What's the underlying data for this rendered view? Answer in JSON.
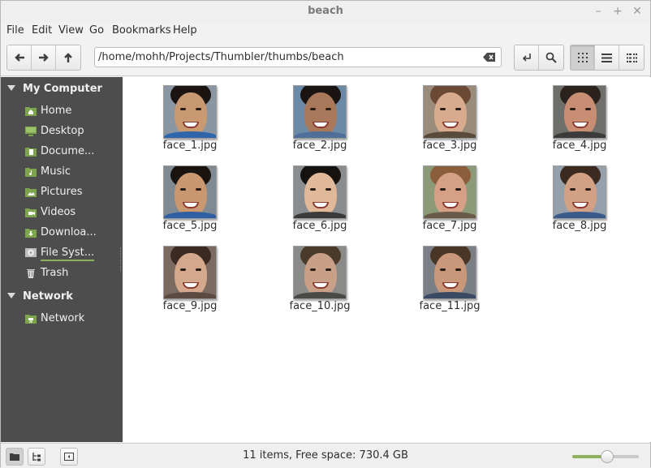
{
  "window": {
    "title": "beach"
  },
  "menu": [
    "File",
    "Edit",
    "View",
    "Go",
    "Bookmarks",
    "Help"
  ],
  "toolbar": {
    "path": "/home/mohh/Projects/Thumbler/thumbs/beach",
    "nav_icons": [
      "back-arrow-icon",
      "forward-arrow-icon",
      "up-arrow-icon"
    ],
    "right_icons": [
      "toggle-location-icon",
      "search-icon"
    ],
    "view_icons": [
      "icon-view-icon",
      "list-view-icon",
      "compact-view-icon"
    ],
    "active_view": "icon-view"
  },
  "sidebar": {
    "sections": [
      {
        "label": "My Computer",
        "items": [
          {
            "label": "Home",
            "icon": "home-folder-icon"
          },
          {
            "label": "Desktop",
            "icon": "desktop-icon"
          },
          {
            "label": "Docume...",
            "icon": "documents-folder-icon"
          },
          {
            "label": "Music",
            "icon": "music-folder-icon"
          },
          {
            "label": "Pictures",
            "icon": "pictures-folder-icon"
          },
          {
            "label": "Videos",
            "icon": "videos-folder-icon"
          },
          {
            "label": "Downloa...",
            "icon": "downloads-folder-icon"
          },
          {
            "label": "File Syst...",
            "icon": "drive-icon"
          },
          {
            "label": "Trash",
            "icon": "trash-icon"
          }
        ]
      },
      {
        "label": "Network",
        "items": [
          {
            "label": "Network",
            "icon": "network-folder-icon"
          }
        ]
      }
    ]
  },
  "files": [
    {
      "name": "face_1.jpg",
      "skin": "#c99a72",
      "hair": "#1b1410",
      "bg": "#8a97a3",
      "shirt": "#2f66a9"
    },
    {
      "name": "face_2.jpg",
      "skin": "#a9785a",
      "hair": "#1a1512",
      "bg": "#6c89a6",
      "shirt": "#4f6f98"
    },
    {
      "name": "face_3.jpg",
      "skin": "#d8ab8e",
      "hair": "#6a4a34",
      "bg": "#9a8c7a",
      "shirt": "#5a4a3c"
    },
    {
      "name": "face_4.jpg",
      "skin": "#c88e74",
      "hair": "#2b221d",
      "bg": "#6e6e6a",
      "shirt": "#3b3b3b"
    },
    {
      "name": "face_5.jpg",
      "skin": "#c99870",
      "hair": "#1a1410",
      "bg": "#7f8a93",
      "shirt": "#2f5fa0"
    },
    {
      "name": "face_6.jpg",
      "skin": "#e0b89a",
      "hair": "#161210",
      "bg": "#8a8d90",
      "shirt": "#3a3a3a"
    },
    {
      "name": "face_7.jpg",
      "skin": "#d6a086",
      "hair": "#8a5e3a",
      "bg": "#8d9a78",
      "shirt": "#6a5a4a"
    },
    {
      "name": "face_8.jpg",
      "skin": "#d2a084",
      "hair": "#3a2a20",
      "bg": "#96a0aa",
      "shirt": "#3a5a8a"
    },
    {
      "name": "face_9.jpg",
      "skin": "#d4a88c",
      "hair": "#3a2a20",
      "bg": "#7a6a60",
      "shirt": "#5a4a40"
    },
    {
      "name": "face_10.jpg",
      "skin": "#c8a088",
      "hair": "#4a3a2a",
      "bg": "#8a8a88",
      "shirt": "#4a4a48"
    },
    {
      "name": "face_11.jpg",
      "skin": "#c9987a",
      "hair": "#4a3626",
      "bg": "#7a8086",
      "shirt": "#3a4a62"
    }
  ],
  "statusbar": {
    "text": "11 items, Free space: 730.4 GB",
    "zoom_level": 0.53,
    "left_icons": [
      "places-sidebar-icon",
      "tree-sidebar-icon",
      "hide-sidebar-icon"
    ]
  },
  "colors": {
    "accent": "#8fb05c",
    "sidebar_bg": "#4d4d4d",
    "folder_green": "#7ea54e"
  }
}
